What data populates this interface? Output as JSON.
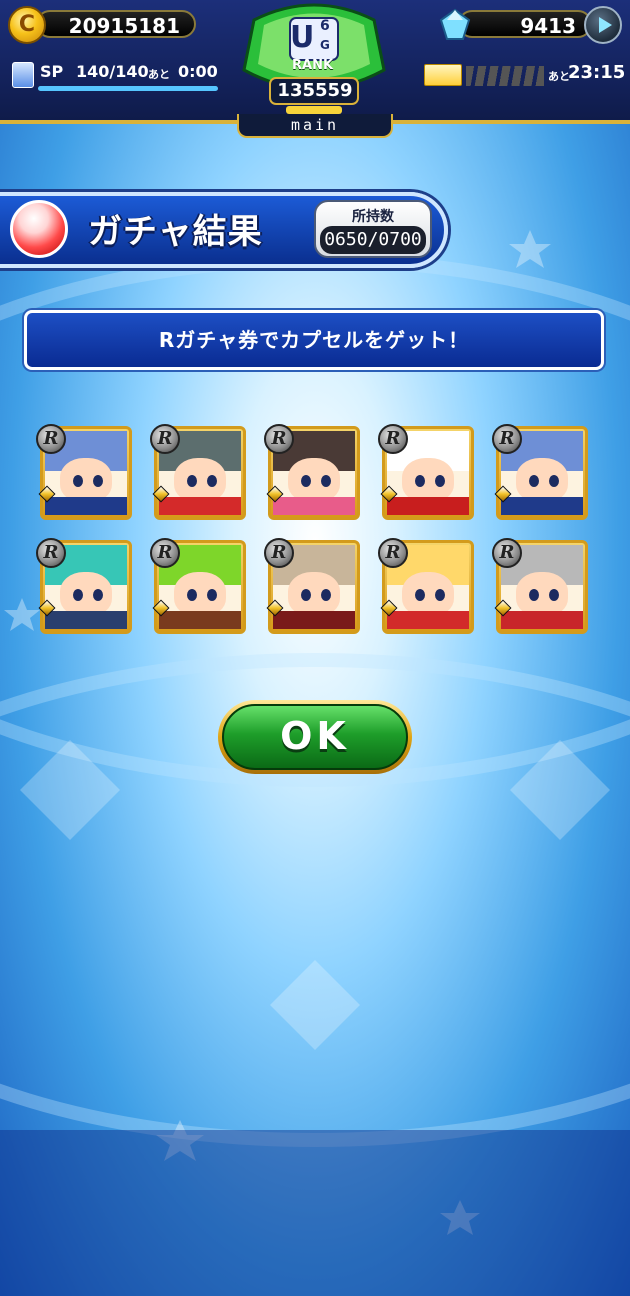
{
  "hud": {
    "coins": "20915181",
    "gems": "9413",
    "sp_label": "SP",
    "sp_value": "140/140",
    "sp_ato": "あと",
    "sp_time": "0:00",
    "rank_letter": "U",
    "rank_sup": "6",
    "rank_sub": "G",
    "rank_label": "RANK",
    "rank_points": "135559",
    "mode_tab": "main",
    "timer_ato": "あと",
    "timer": "23:15"
  },
  "title": {
    "text": "ガチャ結果",
    "possession_label": "所持数",
    "possession_value": "0650/0700"
  },
  "message": "Rガチャ券でカプセルをゲット！",
  "cards": [
    {
      "rarity": "R",
      "hair": "#6e8fd6",
      "body": "#1f3a8a"
    },
    {
      "rarity": "R",
      "hair": "#5c6e6e",
      "body": "#d42a2a"
    },
    {
      "rarity": "R",
      "hair": "#4a3a36",
      "body": "#e85c8a"
    },
    {
      "rarity": "R",
      "hair": "#ffffff",
      "body": "#c81e1e"
    },
    {
      "rarity": "R",
      "hair": "#6e8fd6",
      "body": "#1f3a8a"
    },
    {
      "rarity": "R",
      "hair": "#37c6b6",
      "body": "#2a3f6e"
    },
    {
      "rarity": "R",
      "hair": "#7ed62a",
      "body": "#7a3a1e"
    },
    {
      "rarity": "R",
      "hair": "#c8b59a",
      "body": "#7a1a1a"
    },
    {
      "rarity": "R",
      "hair": "#ffd86a",
      "body": "#d22a2a"
    },
    {
      "rarity": "R",
      "hair": "#b8b8b8",
      "body": "#c8262a"
    }
  ],
  "ok_button": "OK"
}
